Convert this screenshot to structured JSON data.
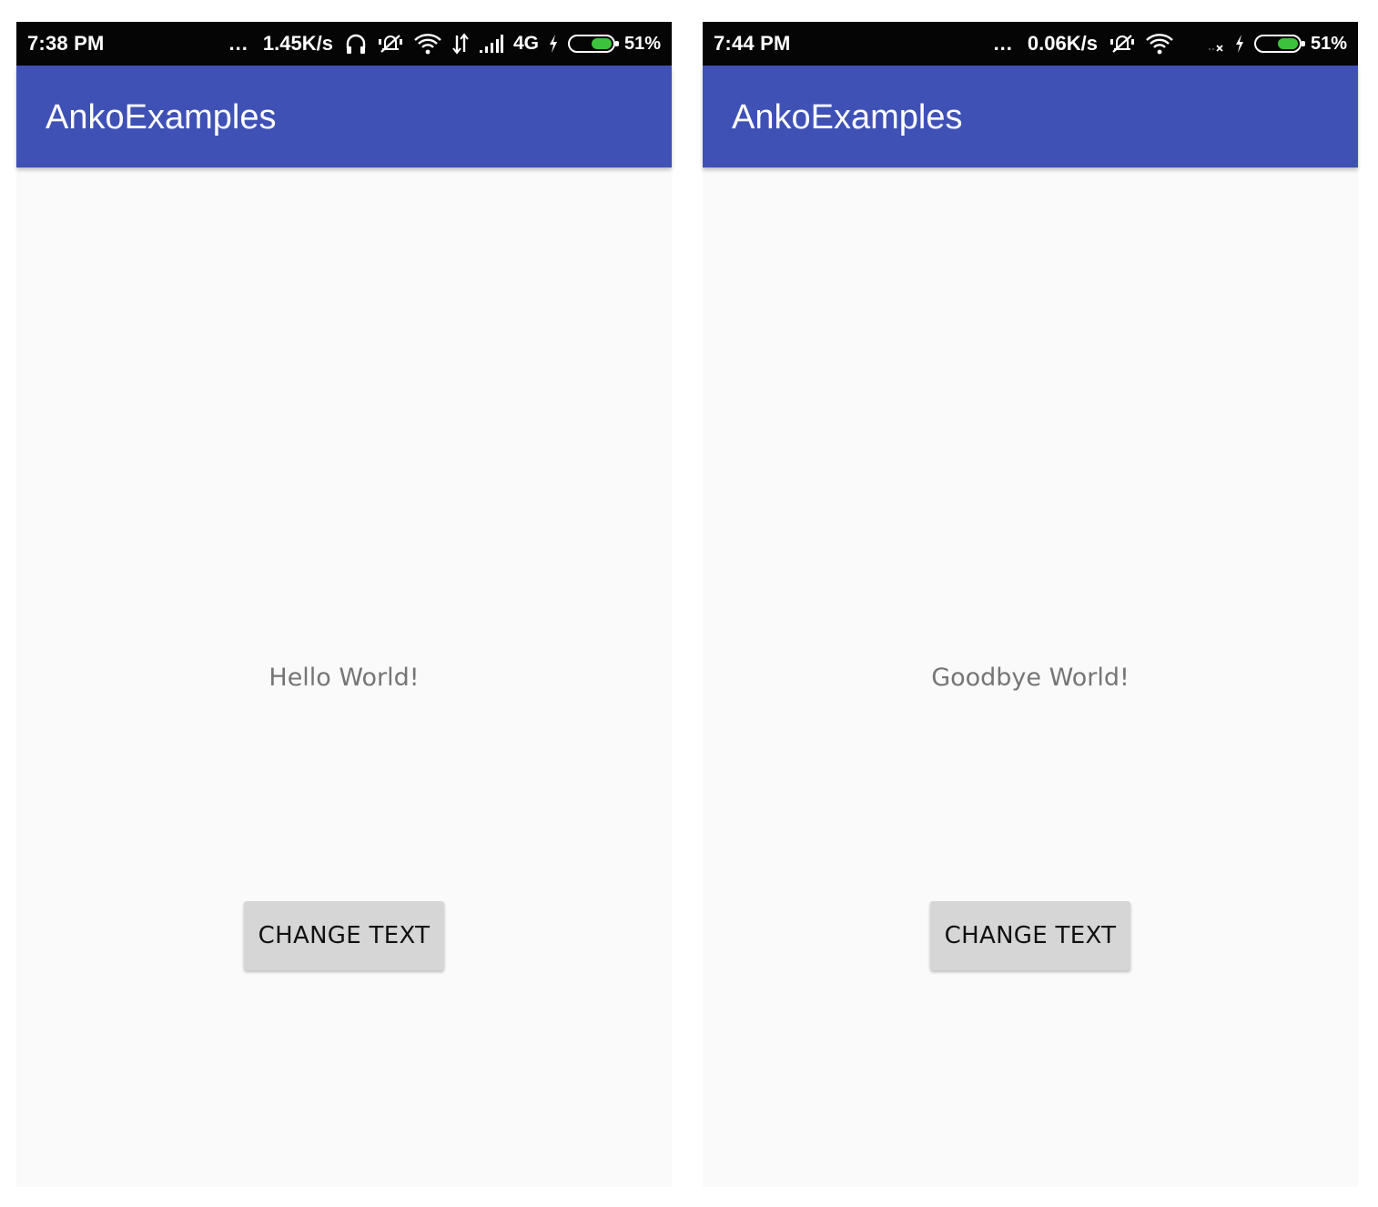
{
  "screens": [
    {
      "status_bar": {
        "time": "7:38 PM",
        "overflow": "...",
        "net_speed": "1.45K/s",
        "network_type": "4G",
        "battery_percent": "51%",
        "battery_level": 0.51,
        "icons": [
          "headphones-icon",
          "mute-icon",
          "wifi-icon",
          "data-arrows-icon",
          "cell-signal-icon",
          "charging-icon",
          "battery-icon"
        ]
      },
      "app_bar": {
        "title": "AnkoExamples"
      },
      "content": {
        "message": "Hello World!",
        "button_label": "CHANGE TEXT"
      }
    },
    {
      "status_bar": {
        "time": "7:44 PM",
        "overflow": "...",
        "net_speed": "0.06K/s",
        "battery_percent": "51%",
        "battery_level": 0.51,
        "icons": [
          "mute-icon",
          "wifi-icon",
          "no-signal-icon",
          "charging-icon",
          "battery-icon"
        ]
      },
      "app_bar": {
        "title": "AnkoExamples"
      },
      "content": {
        "message": "Goodbye World!",
        "button_label": "CHANGE TEXT"
      }
    }
  ],
  "colors": {
    "status_bar_bg": "#050505",
    "app_bar_bg": "#3f51b5",
    "screen_bg": "#fafafa",
    "battery_fill": "#3cc23c",
    "button_bg": "#d6d6d6",
    "message_text": "#757575"
  }
}
